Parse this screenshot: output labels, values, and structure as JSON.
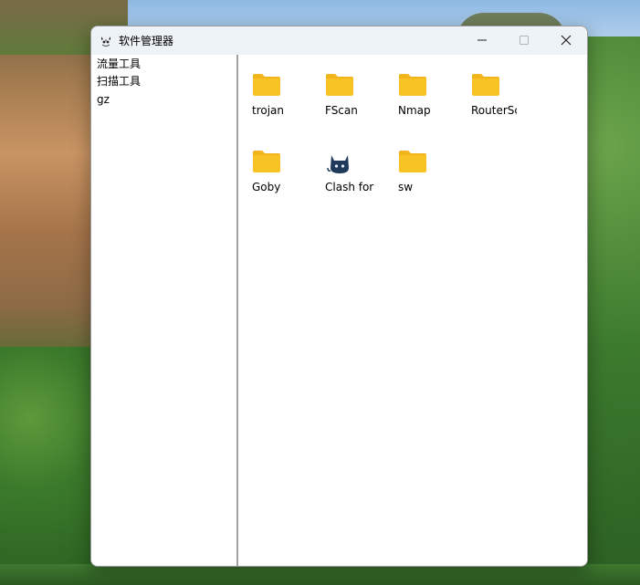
{
  "window": {
    "title": "软件管理器",
    "app_icon": "cat-logo-icon",
    "controls": {
      "minimize_icon": "minimize-icon",
      "maximize_icon": "maximize-icon",
      "close_icon": "close-icon"
    }
  },
  "tree": {
    "items": [
      {
        "label": "流量工具"
      },
      {
        "label": "扫描工具"
      },
      {
        "label": "gz"
      }
    ]
  },
  "files": {
    "items": [
      {
        "label": "trojan",
        "icon": "folder-icon"
      },
      {
        "label": "FScan",
        "icon": "folder-icon"
      },
      {
        "label": "Nmap",
        "icon": "folder-icon"
      },
      {
        "label": "RouterSc",
        "icon": "folder-icon"
      },
      {
        "label": "Goby",
        "icon": "folder-icon"
      },
      {
        "label": "Clash for",
        "icon": "cat-app-icon"
      },
      {
        "label": "sw",
        "icon": "folder-icon"
      }
    ]
  },
  "colors": {
    "folder": "#F7C325",
    "folder_tab": "#F1B41C",
    "titlebar": "#EEF3F8",
    "splitter": "#A0A0A0"
  }
}
